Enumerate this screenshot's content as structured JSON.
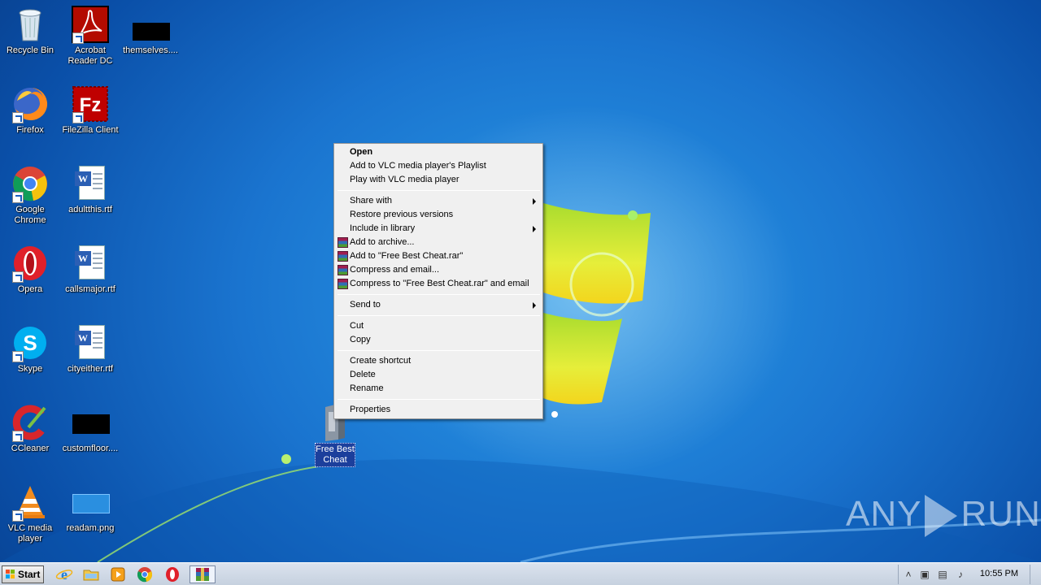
{
  "desktop_icons": [
    {
      "label": "Recycle Bin",
      "icon": "recycle-bin-icon"
    },
    {
      "label": "Acrobat Reader DC",
      "icon": "acrobat-reader-icon"
    },
    {
      "label": "themselves....",
      "icon": "image-thumbnail-icon"
    },
    {
      "label": "Firefox",
      "icon": "firefox-icon"
    },
    {
      "label": "FileZilla Client",
      "icon": "filezilla-icon"
    },
    {
      "label": "Google Chrome",
      "icon": "chrome-icon"
    },
    {
      "label": "adultthis.rtf",
      "icon": "word-document-icon"
    },
    {
      "label": "Opera",
      "icon": "opera-icon"
    },
    {
      "label": "callsmajor.rtf",
      "icon": "word-document-icon"
    },
    {
      "label": "Skype",
      "icon": "skype-icon"
    },
    {
      "label": "cityeither.rtf",
      "icon": "word-document-icon"
    },
    {
      "label": "CCleaner",
      "icon": "ccleaner-icon"
    },
    {
      "label": "customfloor....",
      "icon": "image-thumbnail-icon"
    },
    {
      "label": "VLC media player",
      "icon": "vlc-icon"
    },
    {
      "label": "readam.png",
      "icon": "image-thumbnail-icon"
    }
  ],
  "selected_file": {
    "label": "Free Best Cheat",
    "icon": "executable-file-icon"
  },
  "context_menu": {
    "open": "Open",
    "vlc_playlist": "Add to VLC media player's Playlist",
    "vlc_play": "Play with VLC media player",
    "share_with": "Share with",
    "restore": "Restore previous versions",
    "include_library": "Include in library",
    "add_archive": "Add to archive...",
    "add_rar": "Add to \"Free Best Cheat.rar\"",
    "compress_email": "Compress and email...",
    "compress_rar_email": "Compress to \"Free Best Cheat.rar\" and email",
    "send_to": "Send to",
    "cut": "Cut",
    "copy": "Copy",
    "create_shortcut": "Create shortcut",
    "delete": "Delete",
    "rename": "Rename",
    "properties": "Properties"
  },
  "taskbar": {
    "start_label": "Start",
    "pinned": [
      "internet-explorer-icon",
      "explorer-folder-icon",
      "media-player-icon",
      "chrome-icon",
      "opera-icon",
      "winrar-icon"
    ],
    "clock": "10:55 PM"
  },
  "watermark": {
    "left": "ANY",
    "right": "RUN"
  }
}
